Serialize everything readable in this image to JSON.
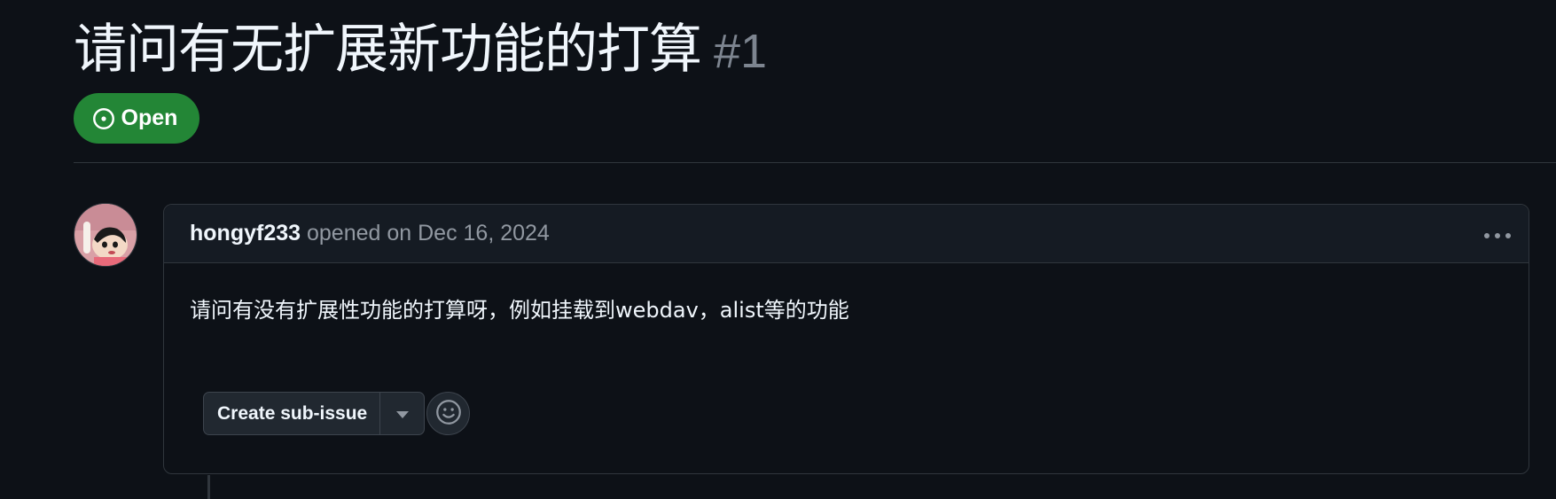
{
  "issue": {
    "title": "请问有无扩展新功能的打算",
    "number": "#1",
    "state": "Open"
  },
  "comment": {
    "author": "hongyf233",
    "opened_text": "opened on Dec 16, 2024",
    "body": "请问有没有扩展性功能的打算呀，例如挂载到webdav，alist等的功能",
    "create_subissue_label": "Create sub-issue"
  },
  "icons": {
    "state": "issue-opened-icon",
    "menu": "kebab-horizontal-icon",
    "dropdown": "triangle-down-icon",
    "reaction": "smiley-icon"
  },
  "colors": {
    "background": "#0d1117",
    "open_badge": "#238636",
    "border": "#30363d",
    "muted_text": "#9198a1"
  }
}
